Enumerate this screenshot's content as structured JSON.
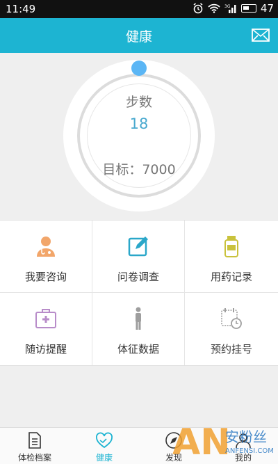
{
  "status": {
    "time": "11:49",
    "battery": "47",
    "signal_label": "3G"
  },
  "header": {
    "title": "健康"
  },
  "steps": {
    "label": "步数",
    "value": "18",
    "goal": "目标：7000"
  },
  "grid": [
    {
      "label": "我要咨询",
      "icon": "doctor-icon"
    },
    {
      "label": "问卷调查",
      "icon": "edit-icon"
    },
    {
      "label": "用药记录",
      "icon": "medicine-bottle-icon"
    },
    {
      "label": "随访提醒",
      "icon": "medical-kit-icon"
    },
    {
      "label": "体征数据",
      "icon": "person-icon"
    },
    {
      "label": "预约挂号",
      "icon": "calendar-clock-icon"
    }
  ],
  "tabs": [
    {
      "label": "体检档案",
      "icon": "document-icon"
    },
    {
      "label": "健康",
      "icon": "heart-hands-icon",
      "active": true
    },
    {
      "label": "发现",
      "icon": "compass-icon"
    },
    {
      "label": "我的",
      "icon": "user-icon"
    }
  ],
  "watermark": {
    "big": "AN",
    "cn": "安粉丝",
    "url": "ANFENSI.COM"
  },
  "colors": {
    "accent": "#1db4d2",
    "knob": "#5bb6f5",
    "steps_value": "#49a9cf"
  }
}
